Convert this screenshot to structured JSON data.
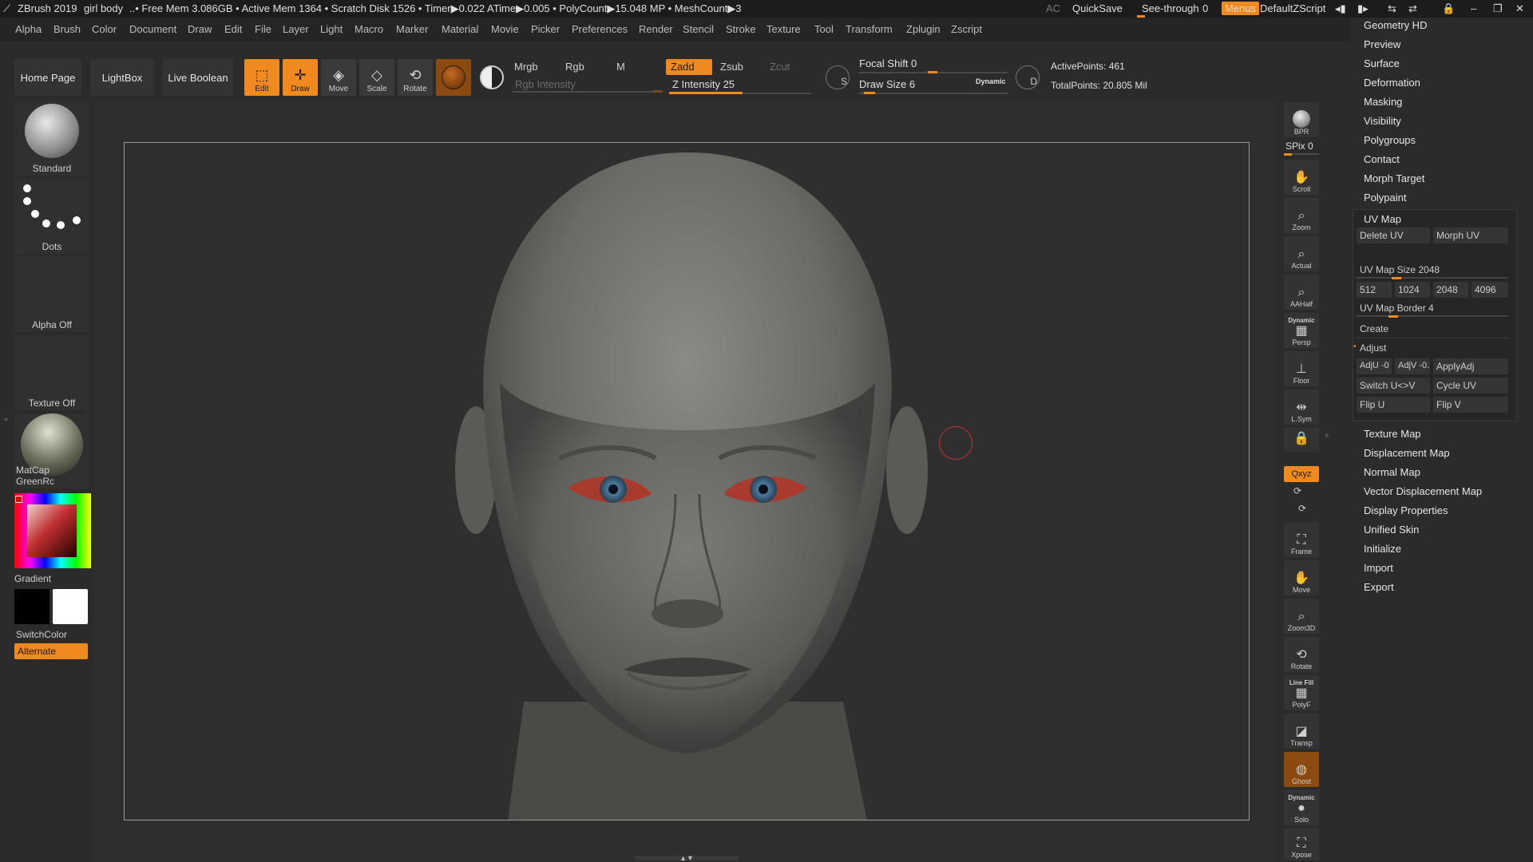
{
  "titlebar": {
    "app": "ZBrush 2019",
    "file": "girl body",
    "stats": "..• Free Mem 3.086GB • Active Mem 1364 • Scratch Disk 1526 • Timer▶0.022 ATime▶0.005 • PolyCount▶15.048 MP • MeshCount▶3",
    "ac": "AC",
    "quicksave": "QuickSave",
    "see_through_label": "See-through",
    "see_through_value": "0",
    "menus": "Menus",
    "script": "DefaultZScript"
  },
  "menubar": [
    "Alpha",
    "Brush",
    "Color",
    "Document",
    "Draw",
    "Edit",
    "File",
    "Layer",
    "Light",
    "Macro",
    "Marker",
    "Material",
    "Movie",
    "Picker",
    "Preferences",
    "Render",
    "Stencil",
    "Stroke",
    "Texture",
    "Tool",
    "Transform",
    "Zplugin",
    "Zscript"
  ],
  "shelf": {
    "home_page": "Home Page",
    "lightbox": "LightBox",
    "live_boolean": "Live Boolean",
    "tools": [
      {
        "label": "Edit",
        "icon": "edit-icon",
        "on": true
      },
      {
        "label": "Draw",
        "icon": "draw-icon",
        "on": true
      },
      {
        "label": "Move",
        "icon": "move-icon",
        "on": false
      },
      {
        "label": "Scale",
        "icon": "scale-icon",
        "on": false
      },
      {
        "label": "Rotate",
        "icon": "rotate-icon",
        "on": false
      }
    ],
    "mrgb": "Mrgb",
    "rgb": "Rgb",
    "m": "M",
    "rgb_intensity": "Rgb Intensity",
    "zadd": "Zadd",
    "zsub": "Zsub",
    "zcut": "Zcut",
    "z_intensity": "Z Intensity 25",
    "focal_shift": "Focal Shift 0",
    "draw_size": "Draw Size 6",
    "dynamic": "Dynamic",
    "active_points": "ActivePoints: 461",
    "total_points": "TotalPoints: 20.805 Mil"
  },
  "lefttray": {
    "brush": "Standard",
    "stroke": "Dots",
    "alpha": "Alpha Off",
    "texture": "Texture Off",
    "material": "MatCap GreenRc",
    "gradient": "Gradient",
    "switchcolor": "SwitchColor",
    "alternate": "Alternate"
  },
  "rstrip": {
    "bpr": "BPR",
    "spix": "SPix 0",
    "buttons": [
      "Scroll",
      "Zoom",
      "Actual",
      "AAHalf",
      "Persp",
      "Floor",
      "L.Sym",
      "Frame",
      "Move",
      "Zoom3D",
      "Rotate",
      "PolyF",
      "Transp",
      "Ghost",
      "Solo",
      "Xpose"
    ],
    "dynamic": "Dynamic",
    "line_fill": "Line Fill",
    "xyz": "Qxyz"
  },
  "rpanel": {
    "top_items": [
      "Geometry HD",
      "Preview",
      "Surface",
      "Deformation",
      "Masking",
      "Visibility",
      "Polygroups",
      "Contact",
      "Morph Target",
      "Polypaint"
    ],
    "uvmap": {
      "title": "UV Map",
      "delete_uv": "Delete UV",
      "morph_uv": "Morph UV",
      "uv_map_size": "UV Map Size 2048",
      "sizes": [
        "512",
        "1024",
        "2048",
        "4096"
      ],
      "uv_map_border": "UV Map Border 4",
      "create": "Create",
      "adjust": "Adjust",
      "adju": "AdjU -0",
      "adjv": "AdjV -0.",
      "applyadj": "ApplyAdj",
      "switch_uv": "Switch U<>V",
      "cycle_uv": "Cycle UV",
      "flip_u": "Flip U",
      "flip_v": "Flip V"
    },
    "bottom_items": [
      "Texture Map",
      "Displacement Map",
      "Normal Map",
      "Vector Displacement Map",
      "Display Properties",
      "Unified Skin",
      "Initialize",
      "Import",
      "Export"
    ]
  },
  "colors": {
    "accent": "#f08a1e",
    "bg": "#2b2b2b"
  }
}
